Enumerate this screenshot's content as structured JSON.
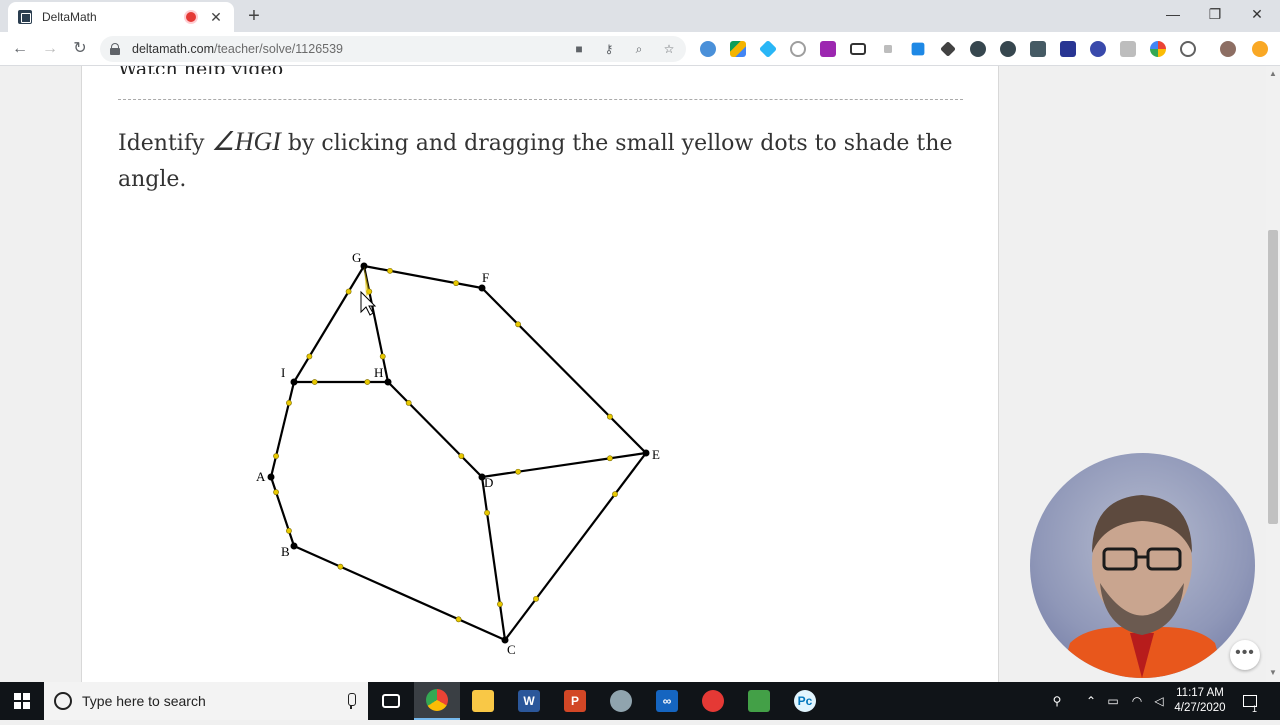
{
  "browser": {
    "tab_title": "DeltaMath",
    "tab_close": "✕",
    "new_tab": "+",
    "window_controls": {
      "minimize": "—",
      "restore": "❐",
      "close": "✕"
    },
    "url_host": "deltamath.com",
    "url_path": "/teacher/solve/1126539"
  },
  "content": {
    "cutoff_heading": "Watch help video",
    "question_before": "Identify ",
    "question_math": "∠HGI",
    "question_after": " by clicking and dragging the small yellow dots to shade the angle."
  },
  "diagram": {
    "points": [
      {
        "name": "G",
        "label": "G"
      },
      {
        "name": "F",
        "label": "F"
      },
      {
        "name": "I",
        "label": "I"
      },
      {
        "name": "H",
        "label": "H"
      },
      {
        "name": "A",
        "label": "A"
      },
      {
        "name": "B",
        "label": "B"
      },
      {
        "name": "D",
        "label": "D"
      },
      {
        "name": "E",
        "label": "E"
      },
      {
        "name": "C",
        "label": "C"
      }
    ],
    "segments": [
      [
        "G",
        "F"
      ],
      [
        "G",
        "I"
      ],
      [
        "G",
        "H"
      ],
      [
        "I",
        "H"
      ],
      [
        "I",
        "A"
      ],
      [
        "A",
        "B"
      ],
      [
        "B",
        "C"
      ],
      [
        "C",
        "D"
      ],
      [
        "C",
        "E"
      ],
      [
        "D",
        "E"
      ],
      [
        "H",
        "D"
      ],
      [
        "F",
        "E"
      ]
    ],
    "handle_color": "#e8c800"
  },
  "taskbar": {
    "search_placeholder": "Type here to search",
    "time": "11:17 AM",
    "date": "4/27/2020",
    "notification_count": "1"
  },
  "colors": {
    "accent": "#1a73e8",
    "taskbar": "#101418"
  }
}
